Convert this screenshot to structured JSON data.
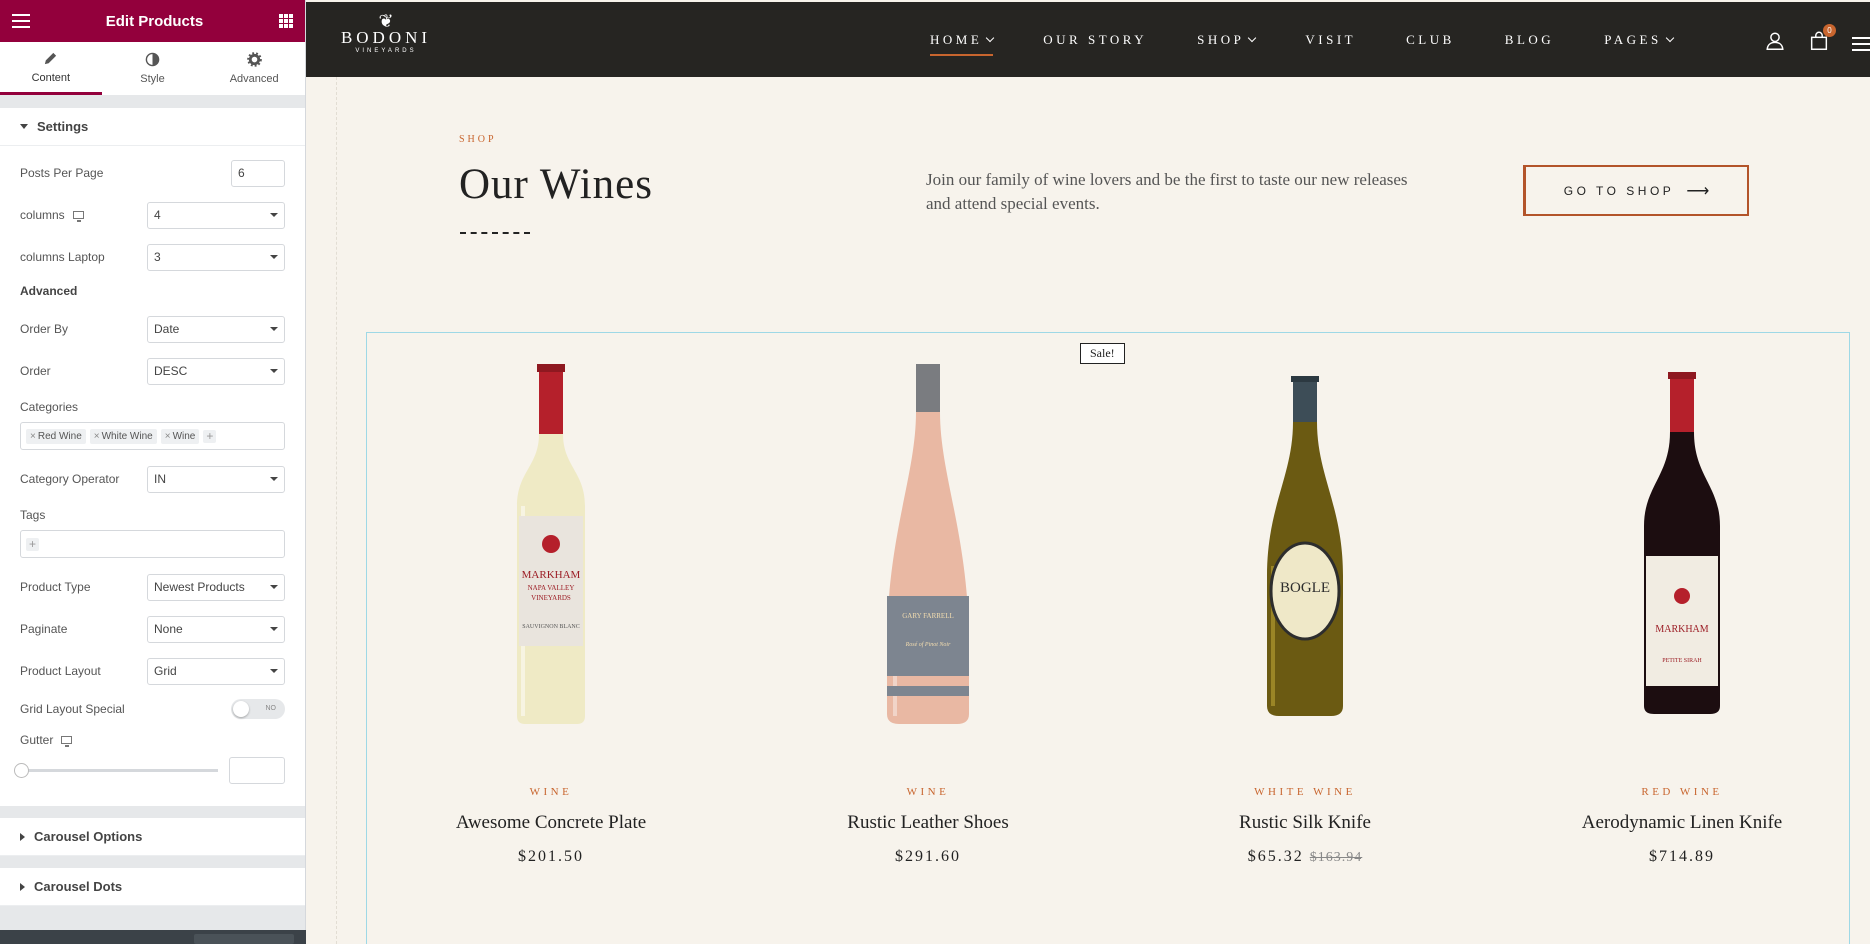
{
  "panel": {
    "title": "Edit Products",
    "tabs": [
      {
        "label": "Content",
        "icon": "pencil-icon"
      },
      {
        "label": "Style",
        "icon": "contrast-icon"
      },
      {
        "label": "Advanced",
        "icon": "gear-icon"
      }
    ],
    "settings": {
      "title": "Settings",
      "posts_per_page": {
        "label": "Posts Per Page",
        "value": "6"
      },
      "columns": {
        "label": "columns",
        "value": "4"
      },
      "columns_laptop": {
        "label": "columns Laptop",
        "value": "3"
      },
      "advanced_heading": "Advanced",
      "order_by": {
        "label": "Order By",
        "value": "Date"
      },
      "order": {
        "label": "Order",
        "value": "DESC"
      },
      "categories": {
        "label": "Categories",
        "chips": [
          "Red Wine",
          "White Wine",
          "Wine"
        ]
      },
      "category_operator": {
        "label": "Category Operator",
        "value": "IN"
      },
      "tags": {
        "label": "Tags"
      },
      "product_type": {
        "label": "Product Type",
        "value": "Newest Products"
      },
      "paginate": {
        "label": "Paginate",
        "value": "None"
      },
      "product_layout": {
        "label": "Product Layout",
        "value": "Grid"
      },
      "grid_layout_special": {
        "label": "Grid Layout Special",
        "toggle": "NO"
      },
      "gutter": {
        "label": "Gutter"
      }
    },
    "carousel_options": "Carousel Options",
    "carousel_dots": "Carousel Dots"
  },
  "site": {
    "logo": {
      "name": "BODONI",
      "sub": "VINEYARDS"
    },
    "nav": [
      {
        "label": "HOME",
        "dropdown": true,
        "active": true
      },
      {
        "label": "OUR STORY",
        "dropdown": false
      },
      {
        "label": "SHOP",
        "dropdown": true
      },
      {
        "label": "VISIT",
        "dropdown": false
      },
      {
        "label": "CLUB",
        "dropdown": false
      },
      {
        "label": "BLOG",
        "dropdown": false
      },
      {
        "label": "PAGES",
        "dropdown": true
      }
    ],
    "cart_count": "0"
  },
  "hero": {
    "eyebrow": "SHOP",
    "title": "Our Wines",
    "intro": "Join our family of wine lovers and be the first to taste our new releases and attend special events.",
    "cta": "GO TO SHOP",
    "cta_arrow": "⟶"
  },
  "products": [
    {
      "category": "WINE",
      "name": "Awesome Concrete Plate",
      "price": "$201.50",
      "old_price": ""
    },
    {
      "category": "WINE",
      "name": "Rustic Leather Shoes",
      "price": "$291.60",
      "old_price": ""
    },
    {
      "category": "WHITE WINE",
      "name": "Rustic Silk Knife",
      "price": "$65.32",
      "old_price": "$163.94",
      "badge": "Sale!"
    },
    {
      "category": "RED WINE",
      "name": "Aerodynamic Linen Knife",
      "price": "$714.89",
      "old_price": ""
    }
  ],
  "bottle_labels": {
    "markham_1": {
      "brand": "MARKHAM",
      "region": "NAPA VALLEY",
      "kind": "VINEYARDS",
      "varietal": "SAUVIGNON BLANC"
    },
    "gary": {
      "brand": "GARY FARRELL",
      "varietal": "Rosé of Pinot Noir"
    },
    "bogle": {
      "brand": "BOGLE"
    },
    "markham_2": {
      "brand": "MARKHAM",
      "varietal": "PETITE SIRAH"
    }
  },
  "colors": {
    "accent": "#93003c",
    "brand": "#c8652e",
    "header": "#262522",
    "page": "#f7f3ec"
  }
}
